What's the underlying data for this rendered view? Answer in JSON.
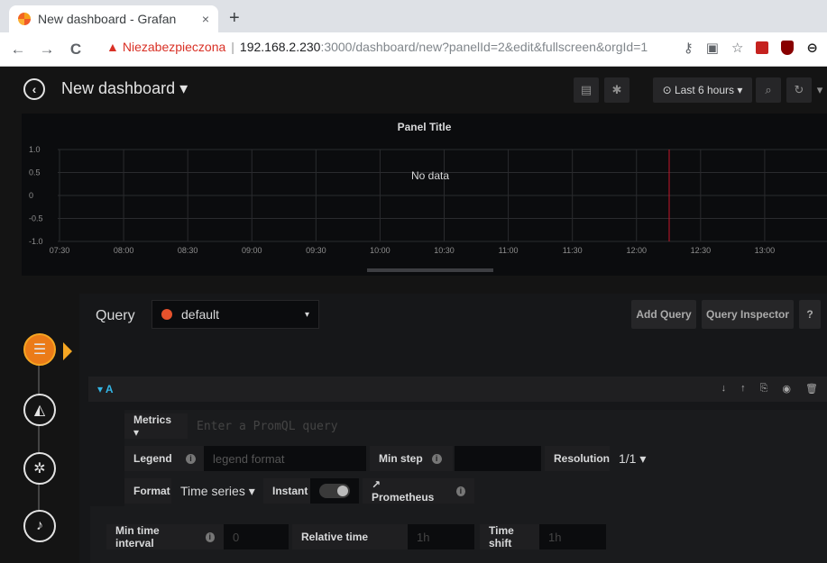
{
  "browser": {
    "tab_title": "New dashboard - Grafan",
    "tab_close": "×",
    "new_tab": "+",
    "url_warning_icon": "warning-icon",
    "url_insecure": "Niezabezpieczona",
    "url_sep": "|",
    "url_host": "192.168.2.230",
    "url_path": ":3000/dashboard/new?panelId=2&edit&fullscreen&orgId=1",
    "back": "←",
    "forward": "→",
    "reload": "C"
  },
  "nav": {
    "dashboard_title": "New dashboard ▾",
    "back_icon": "◀",
    "timepicker": "⊙ Last 6 hours ▾",
    "save_icon": "▤",
    "settings_icon": "✱",
    "zoom_icon": "🔍",
    "refresh_icon": "↻",
    "refresh_caret": "▾"
  },
  "panel": {
    "title": "Panel Title",
    "no_data": "No data",
    "chart_data": {
      "type": "line",
      "title": "Panel Title",
      "x": [
        "07:30",
        "08:00",
        "08:30",
        "09:00",
        "09:30",
        "10:00",
        "10:30",
        "11:00",
        "11:30",
        "12:00",
        "12:30",
        "13:00"
      ],
      "y_ticks": [
        "1.0",
        "0.5",
        "0",
        "-0.5",
        "-1.0"
      ],
      "ylim": [
        -1.0,
        1.0
      ],
      "series": [],
      "grid": true,
      "annotation": "No data"
    }
  },
  "query": {
    "label": "Query",
    "datasource": "default",
    "ds_caret": "▾",
    "add_query": "Add Query",
    "inspector": "Query Inspector",
    "help": "?",
    "row_label": "▾ A",
    "actions": [
      "↓",
      "↑",
      "⎘",
      "◉",
      "🗑"
    ],
    "metrics_label": "Metrics ▾",
    "metrics_placeholder": "Enter a PromQL query",
    "legend_label": "Legend",
    "legend_placeholder": "legend format",
    "minstep_label": "Min step",
    "resolution_label": "Resolution",
    "resolution_value": "1/1 ▾",
    "format_label": "Format",
    "format_value": "Time series ▾",
    "instant_label": "Instant",
    "prometheus_label": "↗ Prometheus",
    "info": "i"
  },
  "options": {
    "min_interval_label": "Min time interval",
    "min_interval_placeholder": "0",
    "relative_label": "Relative time",
    "relative_placeholder": "1h",
    "shift_label": "Time shift",
    "shift_placeholder": "1h"
  }
}
